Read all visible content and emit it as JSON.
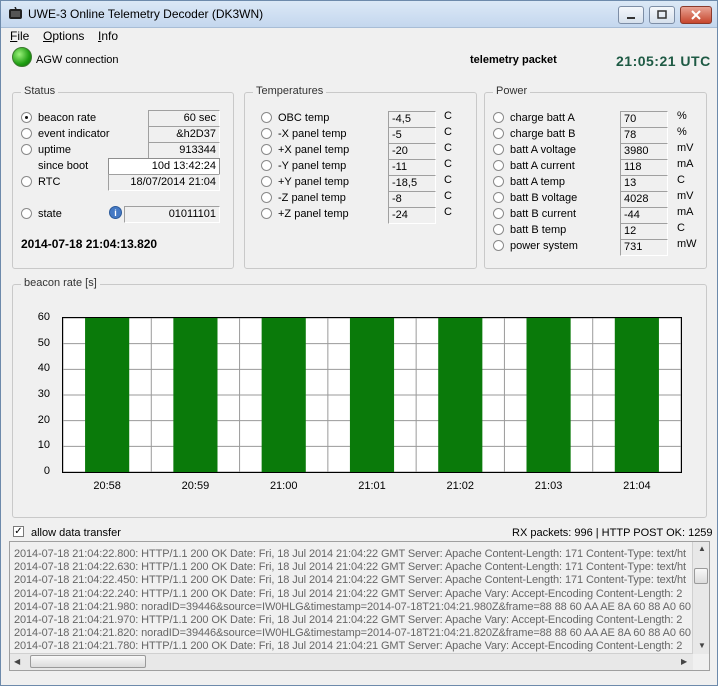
{
  "window": {
    "title": "UWE-3 Online Telemetry Decoder (DK3WN)"
  },
  "menu": {
    "file": "ile",
    "file_key": "F",
    "options": "ptions",
    "options_key": "O",
    "info": "nfo",
    "info_key": "I"
  },
  "header": {
    "agw_label": "AGW connection",
    "packet_label": "telemetry packet",
    "clock": "21:05:21 UTC"
  },
  "status": {
    "legend": "Status",
    "beacon_rate_label": "beacon rate",
    "beacon_rate_value": "60 sec",
    "event_label": "event indicator",
    "event_value": "&h2D37",
    "uptime_label": "uptime",
    "uptime_value": "913344",
    "since_boot_label": "since boot",
    "since_boot_value": "10d 13:42:24",
    "rtc_label": "RTC",
    "rtc_value": "18/07/2014 21:04",
    "state_label": "state",
    "state_value": "01011101",
    "info_icon": "i",
    "timestamp": "2014-07-18 21:04:13.820"
  },
  "temperatures": {
    "legend": "Temperatures",
    "rows": [
      {
        "label": "OBC temp",
        "value": "-4,5",
        "unit": "C"
      },
      {
        "label": "-X panel temp",
        "value": "-5",
        "unit": "C"
      },
      {
        "label": "+X panel temp",
        "value": "-20",
        "unit": "C"
      },
      {
        "label": "-Y panel temp",
        "value": "-11",
        "unit": "C"
      },
      {
        "label": "+Y panel temp",
        "value": "-18,5",
        "unit": "C"
      },
      {
        "label": "-Z panel temp",
        "value": "-8",
        "unit": "C"
      },
      {
        "label": "+Z panel temp",
        "value": "-24",
        "unit": "C"
      }
    ]
  },
  "power": {
    "legend": "Power",
    "rows": [
      {
        "label": "charge batt A",
        "value": "70",
        "unit": "%"
      },
      {
        "label": "charge batt B",
        "value": "78",
        "unit": "%"
      },
      {
        "label": "batt A voltage",
        "value": "3980",
        "unit": "mV"
      },
      {
        "label": "batt A current",
        "value": "118",
        "unit": "mA"
      },
      {
        "label": "batt A temp",
        "value": "13",
        "unit": "C"
      },
      {
        "label": "batt B voltage",
        "value": "4028",
        "unit": "mV"
      },
      {
        "label": "batt B current",
        "value": "-44",
        "unit": "mA"
      },
      {
        "label": "batt B temp",
        "value": "12",
        "unit": "C"
      },
      {
        "label": "power system",
        "value": "731",
        "unit": "mW"
      }
    ]
  },
  "chart_data": {
    "type": "bar",
    "title": "beacon rate [s]",
    "categories": [
      "20:58",
      "20:59",
      "21:00",
      "21:01",
      "21:02",
      "21:03",
      "21:04"
    ],
    "values": [
      60,
      60,
      60,
      60,
      60,
      60,
      60
    ],
    "yticks": [
      "0",
      "10",
      "20",
      "30",
      "40",
      "50",
      "60"
    ],
    "ylim": [
      0,
      60
    ],
    "grid": true,
    "bar_color": "#0a7a0a"
  },
  "footer": {
    "allow_label": "allow data transfer",
    "allow_checked": "✓",
    "rx_label": "RX packets: 996 | HTTP POST OK: 1259"
  },
  "log": {
    "lines": [
      "2014-07-18 21:04:22.800: HTTP/1.1 200 OK Date: Fri, 18 Jul 2014 21:04:22 GMT Server: Apache Content-Length: 171 Content-Type: text/ht",
      "2014-07-18 21:04:22.630: HTTP/1.1 200 OK Date: Fri, 18 Jul 2014 21:04:22 GMT Server: Apache Content-Length: 171 Content-Type: text/ht",
      "2014-07-18 21:04:22.450: HTTP/1.1 200 OK Date: Fri, 18 Jul 2014 21:04:22 GMT Server: Apache Content-Length: 171 Content-Type: text/ht",
      "2014-07-18 21:04:22.240: HTTP/1.1 200 OK Date: Fri, 18 Jul 2014 21:04:22 GMT Server: Apache Vary: Accept-Encoding Content-Length: 2",
      "2014-07-18 21:04:21.980: noradID=39446&source=IW0HLG&timestamp=2014-07-18T21:04:21.980Z&frame=88 88 60 AA AE 8A 60 88 A0 60 A",
      "2014-07-18 21:04:21.970: HTTP/1.1 200 OK Date: Fri, 18 Jul 2014 21:04:22 GMT Server: Apache Vary: Accept-Encoding Content-Length: 2",
      "2014-07-18 21:04:21.820: noradID=39446&source=IW0HLG&timestamp=2014-07-18T21:04:21.820Z&frame=88 88 60 AA AE 8A 60 88 A0 60 A",
      "2014-07-18 21:04:21.780: HTTP/1.1 200 OK Date: Fri, 18 Jul 2014 21:04:21 GMT Server: Apache Vary: Accept-Encoding Content-Length: 2"
    ]
  }
}
